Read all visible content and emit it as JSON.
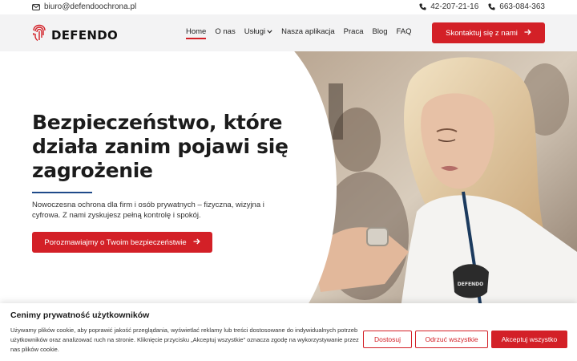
{
  "topbar": {
    "email": "biuro@defendoochrona.pl",
    "phone_1": "42-207-21-16",
    "phone_2": "663-084-363"
  },
  "header": {
    "logo_text": "DEFENDO",
    "nav": {
      "home": "Home",
      "about": "O nas",
      "services": "Usługi",
      "app": "Nasza aplikacja",
      "jobs": "Praca",
      "blog": "Blog",
      "faq": "FAQ"
    },
    "cta_label": "Skontaktuj się z nami"
  },
  "hero": {
    "title": "Bezpieczeństwo, które działa zanim pojawi się zagrożenie",
    "description": "Nowoczesna ochrona dla firm i osób prywatnych – fizyczna, wizyjna i cyfrowa. Z nami zyskujesz pełną kontrolę i spokój.",
    "button_label": "Porozmawiajmy o Twoim bezpieczeństwie",
    "badge_text": "DEFENDO"
  },
  "cookie": {
    "title": "Cenimy prywatność użytkowników",
    "text": "Używamy plików cookie, aby poprawić jakość przeglądania, wyświetlać reklamy lub treści dostosowane do indywidualnych potrzeb użytkowników oraz analizować ruch na stronie. Kliknięcie przycisku „Akceptuj wszystkie” oznacza zgodę na wykorzystywanie przez nas plików cookie.",
    "customize_label": "Dostosuj",
    "reject_label": "Odrzuć wszystkie",
    "accept_label": "Akceptuj wszystko"
  },
  "colors": {
    "accent": "#d32027",
    "header_bg": "#f3f3f4",
    "divider_blue": "#1f4a8a"
  },
  "icons": [
    "envelope-icon",
    "phone-icon",
    "fingerprint-logo-icon",
    "chevron-down-icon",
    "arrow-right-icon"
  ]
}
